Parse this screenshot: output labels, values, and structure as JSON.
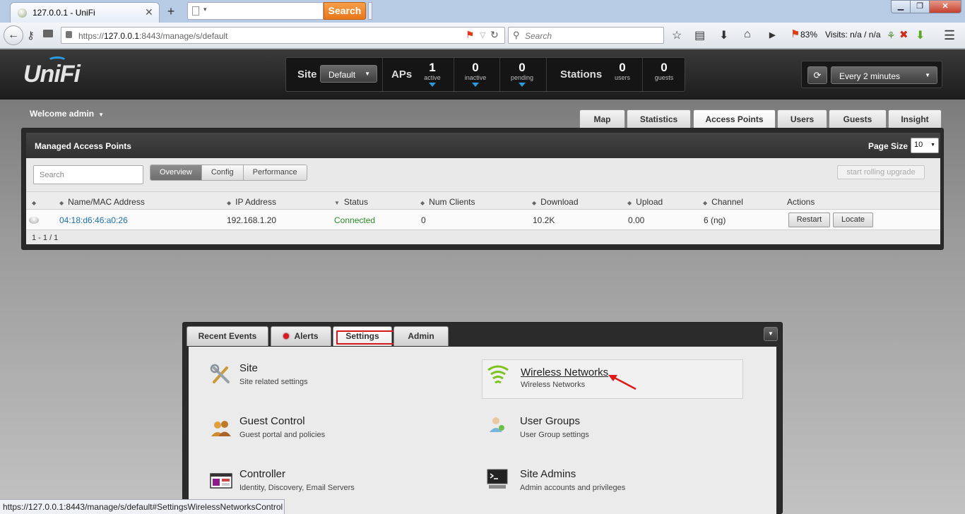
{
  "browser": {
    "tab_title": "127.0.0.1 - UniFi",
    "new_tab": "+",
    "search_button": "Search",
    "url_host_prefix": "https://",
    "url_host": "127.0.0.1",
    "url_rest": ":8443/manage/s/default",
    "search_placeholder": "Search",
    "zoom_percent": "83%",
    "visits": "Visits: n/a / n/a",
    "status_url": "https://127.0.0.1:8443/manage/s/default#SettingsWirelessNetworksControl"
  },
  "header": {
    "logo": "UniFi",
    "site_label": "Site",
    "site_value": "Default",
    "aps_label": "APs",
    "stations_label": "Stations",
    "stats": [
      {
        "value": "1",
        "label": "active"
      },
      {
        "value": "0",
        "label": "inactive"
      },
      {
        "value": "0",
        "label": "pending"
      },
      {
        "value": "0",
        "label": "users"
      },
      {
        "value": "0",
        "label": "guests"
      }
    ],
    "refresh_interval": "Every 2 minutes"
  },
  "welcome": "Welcome admin",
  "nav_tabs": [
    "Map",
    "Statistics",
    "Access Points",
    "Users",
    "Guests",
    "Insight"
  ],
  "active_nav_tab": "Access Points",
  "ap_panel": {
    "title": "Managed Access Points",
    "page_size_label": "Page Size",
    "page_size": "10",
    "search_placeholder": "Search",
    "view_tabs": [
      "Overview",
      "Config",
      "Performance"
    ],
    "rolling_upgrade": "start rolling upgrade",
    "columns": [
      "Name/MAC Address",
      "IP Address",
      "Status",
      "Num Clients",
      "Download",
      "Upload",
      "Channel",
      "Actions"
    ],
    "rows": [
      {
        "name": "04:18:d6:46:a0:26",
        "ip": "192.168.1.20",
        "status": "Connected",
        "clients": "0",
        "download": "10.2K",
        "upload": "0.00",
        "channel": "6 (ng)",
        "actions": [
          "Restart",
          "Locate"
        ]
      }
    ],
    "pager": "1 - 1 / 1"
  },
  "bottom_panel": {
    "tabs": [
      "Recent Events",
      "Alerts",
      "Settings",
      "Admin"
    ],
    "active_tab": "Settings",
    "items": [
      {
        "title": "Site",
        "subtitle": "Site related settings",
        "icon": "tools-icon"
      },
      {
        "title": "Wireless Networks",
        "subtitle": "Wireless Networks",
        "icon": "wifi-icon"
      },
      {
        "title": "Guest Control",
        "subtitle": "Guest portal and policies",
        "icon": "guests-icon"
      },
      {
        "title": "User Groups",
        "subtitle": "User Group settings",
        "icon": "user-group-icon"
      },
      {
        "title": "Controller",
        "subtitle": "Identity, Discovery, Email Servers",
        "icon": "controller-icon"
      },
      {
        "title": "Site Admins",
        "subtitle": "Admin accounts and privileges",
        "icon": "terminal-icon"
      }
    ]
  },
  "colors": {
    "accent_blue": "#2b9be0",
    "highlight_red": "#d6191f",
    "status_green": "#2d8a2d",
    "wifi_green": "#7cc21a"
  }
}
